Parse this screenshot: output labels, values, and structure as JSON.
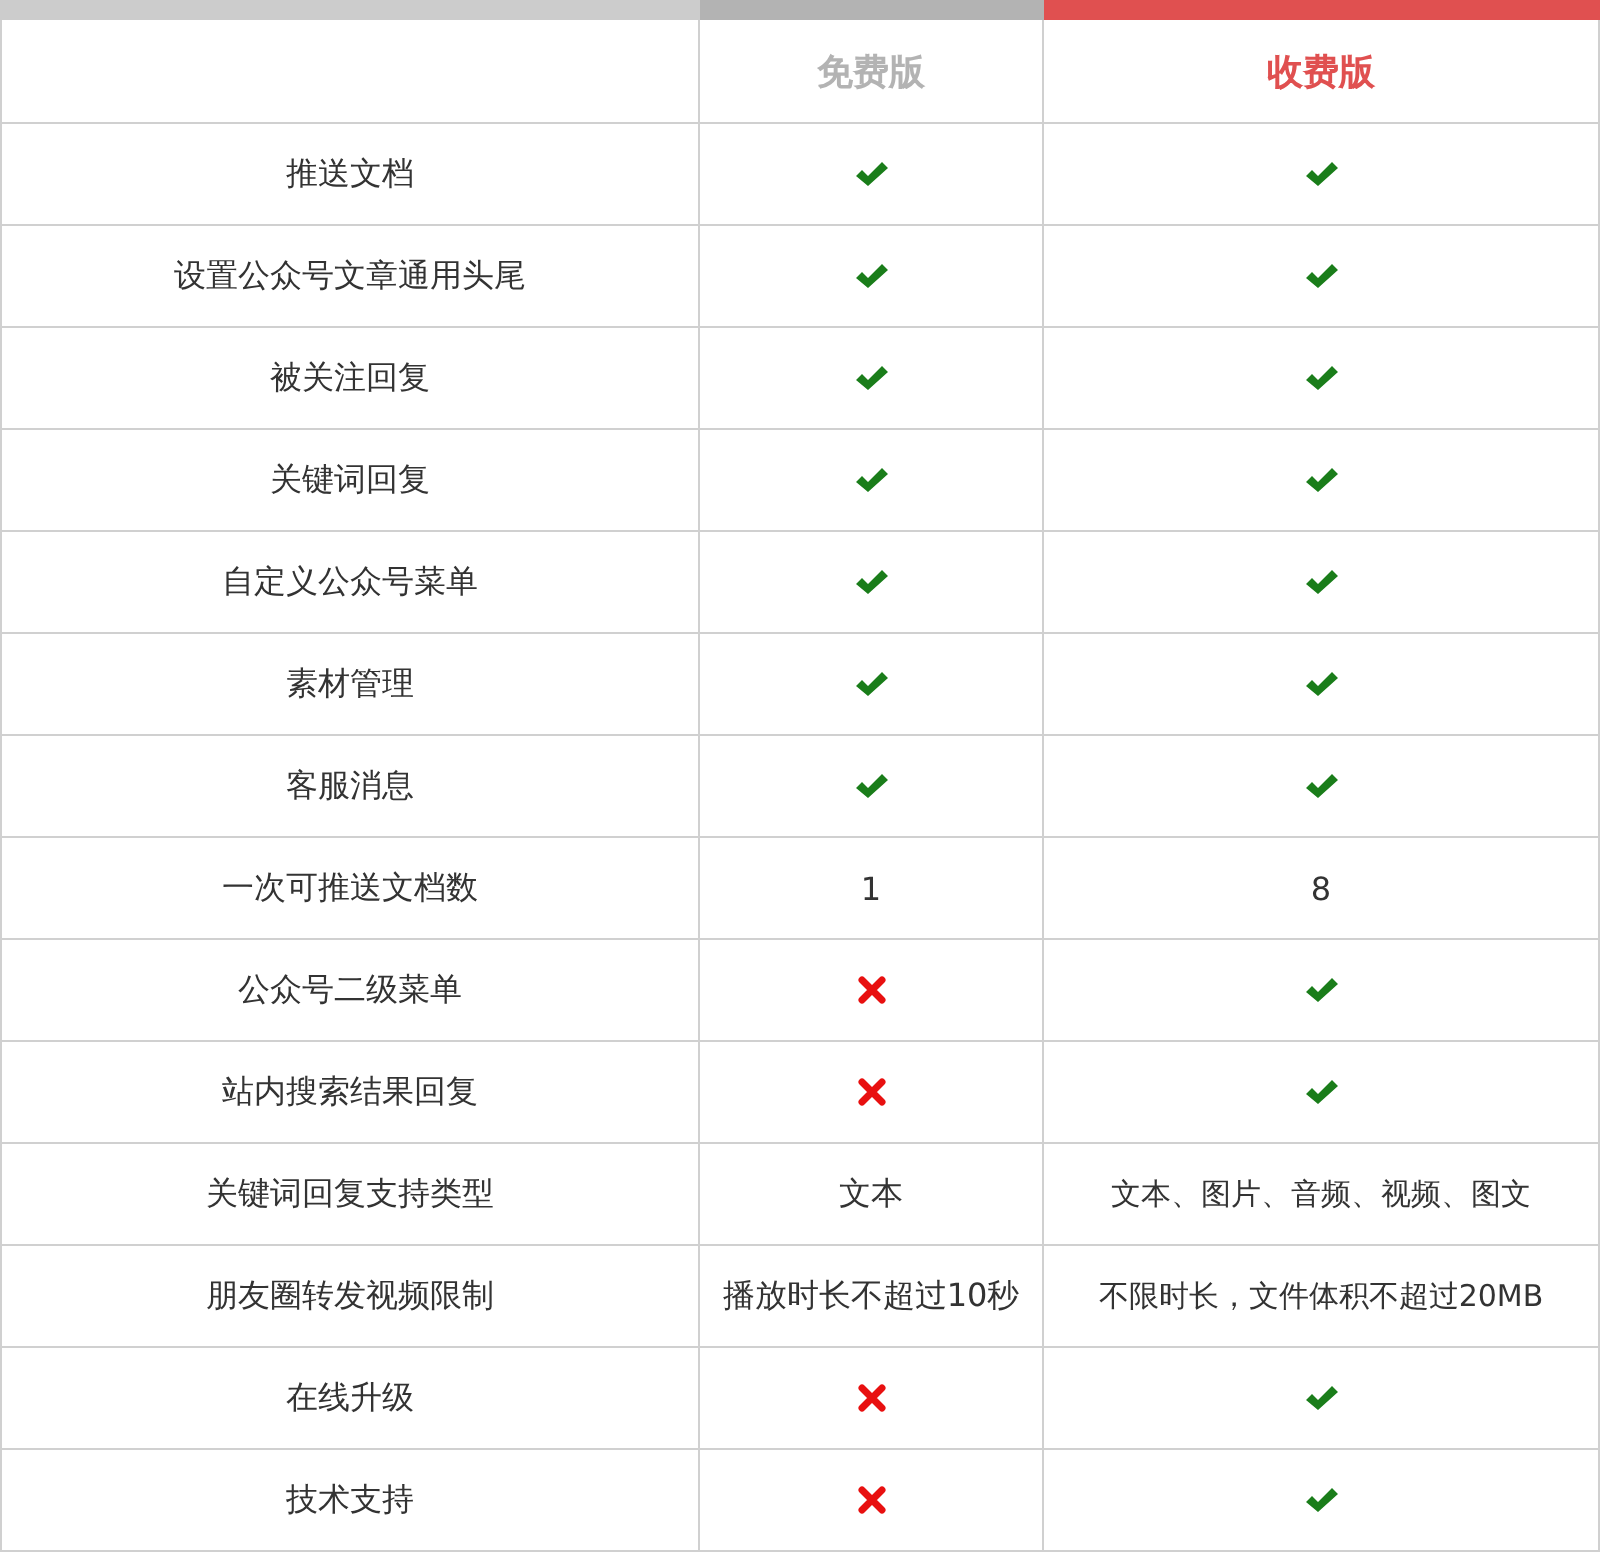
{
  "plans": [
    {
      "name": "免费版",
      "color": "#b3b3b3"
    },
    {
      "name": "收费版",
      "color": "#e05050"
    }
  ],
  "rows": [
    {
      "feature": "推送文档",
      "cells": [
        {
          "kind": "yes"
        },
        {
          "kind": "yes"
        }
      ]
    },
    {
      "feature": "设置公众号文章通用头尾",
      "cells": [
        {
          "kind": "yes"
        },
        {
          "kind": "yes"
        }
      ]
    },
    {
      "feature": "被关注回复",
      "cells": [
        {
          "kind": "yes"
        },
        {
          "kind": "yes"
        }
      ]
    },
    {
      "feature": "关键词回复",
      "cells": [
        {
          "kind": "yes"
        },
        {
          "kind": "yes"
        }
      ]
    },
    {
      "feature": "自定义公众号菜单",
      "cells": [
        {
          "kind": "yes"
        },
        {
          "kind": "yes"
        }
      ]
    },
    {
      "feature": "素材管理",
      "cells": [
        {
          "kind": "yes"
        },
        {
          "kind": "yes"
        }
      ]
    },
    {
      "feature": "客服消息",
      "cells": [
        {
          "kind": "yes"
        },
        {
          "kind": "yes"
        }
      ]
    },
    {
      "feature": "一次可推送文档数",
      "cells": [
        {
          "kind": "text",
          "text": "1"
        },
        {
          "kind": "text",
          "text": "8"
        }
      ]
    },
    {
      "feature": "公众号二级菜单",
      "cells": [
        {
          "kind": "no"
        },
        {
          "kind": "yes"
        }
      ]
    },
    {
      "feature": "站内搜索结果回复",
      "cells": [
        {
          "kind": "no"
        },
        {
          "kind": "yes"
        }
      ]
    },
    {
      "feature": "关键词回复支持类型",
      "cells": [
        {
          "kind": "text",
          "text": "文本"
        },
        {
          "kind": "text",
          "text": "文本、图片、音频、视频、图文"
        }
      ]
    },
    {
      "feature": "朋友圈转发视频限制",
      "cells": [
        {
          "kind": "text",
          "text": "播放时长不超过10秒"
        },
        {
          "kind": "text",
          "text": "不限时长，文件体积不超过20MB"
        }
      ]
    },
    {
      "feature": "在线升级",
      "cells": [
        {
          "kind": "no"
        },
        {
          "kind": "yes"
        }
      ]
    },
    {
      "feature": "技术支持",
      "cells": [
        {
          "kind": "no"
        },
        {
          "kind": "yes"
        }
      ]
    }
  ]
}
